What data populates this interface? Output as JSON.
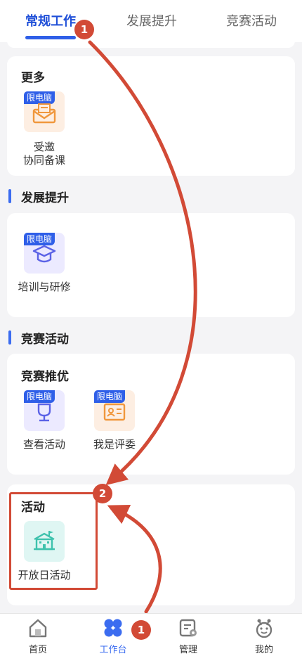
{
  "tabs": [
    "常规工作",
    "发展提升",
    "竞赛活动"
  ],
  "sections": {
    "more": {
      "title": "更多",
      "apps": [
        {
          "badge": "限电脑",
          "label_line1": "受邀",
          "label_line2": "协同备课",
          "icon": "envelope-icon"
        }
      ]
    },
    "development": {
      "title": "发展提升",
      "apps": [
        {
          "badge": "限电脑",
          "label": "培训与研修",
          "icon": "graduation-cap-icon"
        }
      ]
    },
    "competition": {
      "title": "竞赛活动",
      "subtitle": "竞赛推优",
      "apps": [
        {
          "badge": "限电脑",
          "label": "查看活动",
          "icon": "trophy-icon"
        },
        {
          "badge": "限电脑",
          "label": "我是评委",
          "icon": "id-card-icon"
        }
      ]
    },
    "activity": {
      "title": "活动",
      "apps": [
        {
          "label": "开放日活动",
          "icon": "school-building-icon"
        }
      ]
    }
  },
  "annotations": {
    "marker_1": "1",
    "marker_2": "2",
    "marker_3": "1"
  },
  "bottom_nav": [
    {
      "label": "首页",
      "icon": "home-icon"
    },
    {
      "label": "工作台",
      "icon": "workbench-icon",
      "active": true
    },
    {
      "label": "管理",
      "icon": "manage-icon"
    },
    {
      "label": "我的",
      "icon": "profile-icon"
    }
  ],
  "colors": {
    "accent": "#3b6cf0",
    "annotation": "#d24a36"
  }
}
